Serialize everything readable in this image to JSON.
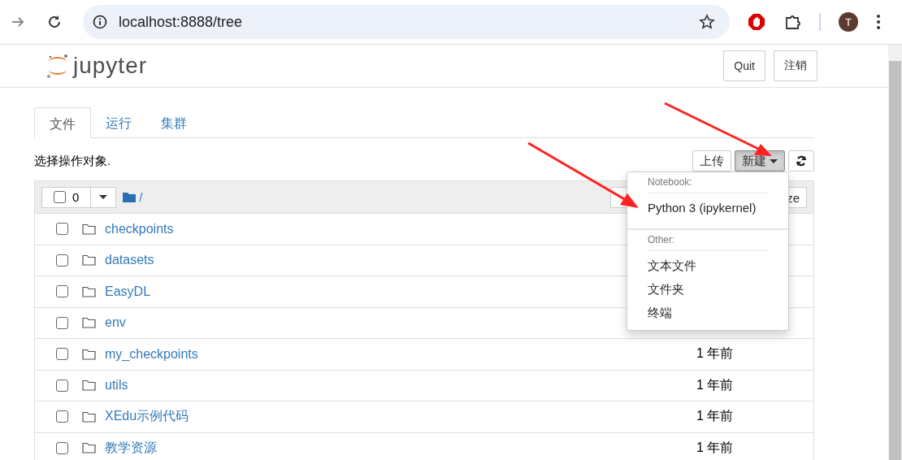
{
  "browser": {
    "url": "localhost:8888/tree",
    "avatar_letter": "T"
  },
  "header": {
    "logo_text": "jupyter",
    "buttons": [
      "Quit",
      "注销"
    ]
  },
  "tabs": [
    {
      "label": "文件",
      "selected": true
    },
    {
      "label": "运行",
      "selected": false
    },
    {
      "label": "集群",
      "selected": false
    }
  ],
  "toolbar": {
    "hint": "选择操作对象.",
    "buttons": [
      "上传",
      "新建"
    ]
  },
  "list_header": {
    "checked": false,
    "selected_count": "0",
    "path": "/",
    "size_button": "ze"
  },
  "rows": [
    {
      "name": "checkpoints",
      "checked": false
    },
    {
      "name": "datasets",
      "checked": false
    },
    {
      "name": "EasyDL",
      "checked": false
    },
    {
      "name": "env",
      "checked": false
    },
    {
      "name": "my_checkpoints",
      "checked": false,
      "modified": "1 年前"
    },
    {
      "name": "utils",
      "checked": false,
      "modified": "1 年前"
    },
    {
      "name": "XEdu示例代码",
      "checked": false,
      "modified": "1 年前"
    },
    {
      "name": "教学资源",
      "checked": false,
      "modified": "1 年前"
    }
  ],
  "new_menu": {
    "open": true,
    "sections": [
      {
        "heading": "Notebook:",
        "items": [
          "Python 3 (ipykernel)"
        ]
      },
      {
        "heading": "Other:",
        "items": [
          "文本文件",
          "文件夹",
          "终端"
        ]
      }
    ]
  }
}
